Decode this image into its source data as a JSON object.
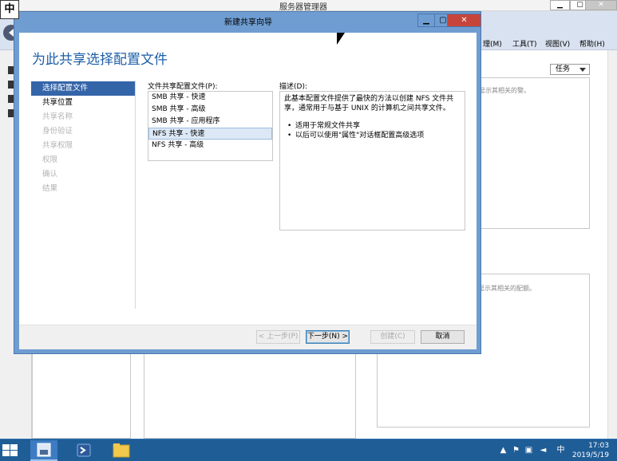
{
  "ime": {
    "label": "中"
  },
  "server_manager": {
    "title": "服务器管理器",
    "menu": {
      "manage": "理(M)",
      "tools": "工具(T)",
      "view": "视图(V)",
      "help": "帮助(H)"
    },
    "tasks_dropdown": "任务",
    "hint_top": "显示其相关的警。",
    "hint_bottom": "显示其相关的配额。"
  },
  "dialog": {
    "title": "新建共享向导",
    "heading": "为此共享选择配置文件",
    "steps": [
      {
        "label": "选择配置文件",
        "state": "active"
      },
      {
        "label": "共享位置",
        "state": "enabled"
      },
      {
        "label": "共享名称",
        "state": "disabled"
      },
      {
        "label": "身份验证",
        "state": "disabled"
      },
      {
        "label": "共享权限",
        "state": "disabled"
      },
      {
        "label": "权限",
        "state": "disabled"
      },
      {
        "label": "确认",
        "state": "disabled"
      },
      {
        "label": "结果",
        "state": "disabled"
      }
    ],
    "profile_label": "文件共享配置文件(P):",
    "profiles": [
      {
        "label": "SMB 共享 - 快速",
        "selected": false
      },
      {
        "label": "SMB 共享 - 高级",
        "selected": false
      },
      {
        "label": "SMB 共享 - 应用程序",
        "selected": false
      },
      {
        "label": "NFS 共享 - 快速",
        "selected": true
      },
      {
        "label": "NFS 共享 - 高级",
        "selected": false
      }
    ],
    "description_label": "描述(D):",
    "description_text": "此基本配置文件提供了最快的方法以创建 NFS 文件共享，通常用于与基于 UNIX 的计算机之间共享文件。",
    "description_bullets": [
      "适用于常规文件共享",
      "以后可以使用\"属性\"对话框配置高级选项"
    ],
    "buttons": {
      "prev": "< 上一步(P)",
      "next": "下一步(N) >",
      "create": "创建(C)",
      "cancel": "取消"
    }
  },
  "taskbar": {
    "time": "17:03",
    "date": "2019/5/19",
    "ime_tray": "中"
  }
}
